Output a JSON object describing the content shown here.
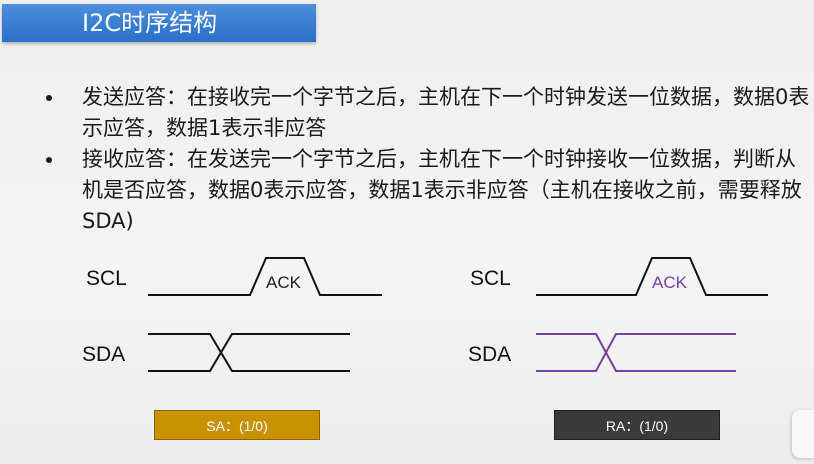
{
  "title": "I2C时序结构",
  "bullets": [
    {
      "text": "发送应答：在接收完一个字节之后，主机在下一个时钟发送一位数据，数据0表示应答，数据1表示非应答"
    },
    {
      "text": "接收应答：在发送完一个字节之后，主机在下一个时钟接收一位数据，判断从机是否应答，数据0表示应答，数据1表示非应答（主机在接收之前，需要释放SDA)"
    }
  ],
  "diagrams": [
    {
      "scl_label": "SCL",
      "sda_label": "SDA",
      "ack_label": "ACK",
      "ack_color": "#222222",
      "sda_color": "#111111"
    },
    {
      "scl_label": "SCL",
      "sda_label": "SDA",
      "ack_label": "ACK",
      "ack_color": "#7b3fa0",
      "sda_color": "#7b3fa0"
    }
  ],
  "legend": {
    "sa": {
      "label": "SA：(1/0)",
      "color": "#c79100"
    },
    "ra": {
      "label": "RA：(1/0)",
      "color": "#3a3a3a"
    }
  },
  "colors": {
    "title_bg": "#2a6fca",
    "title_text": "#ffffff"
  }
}
